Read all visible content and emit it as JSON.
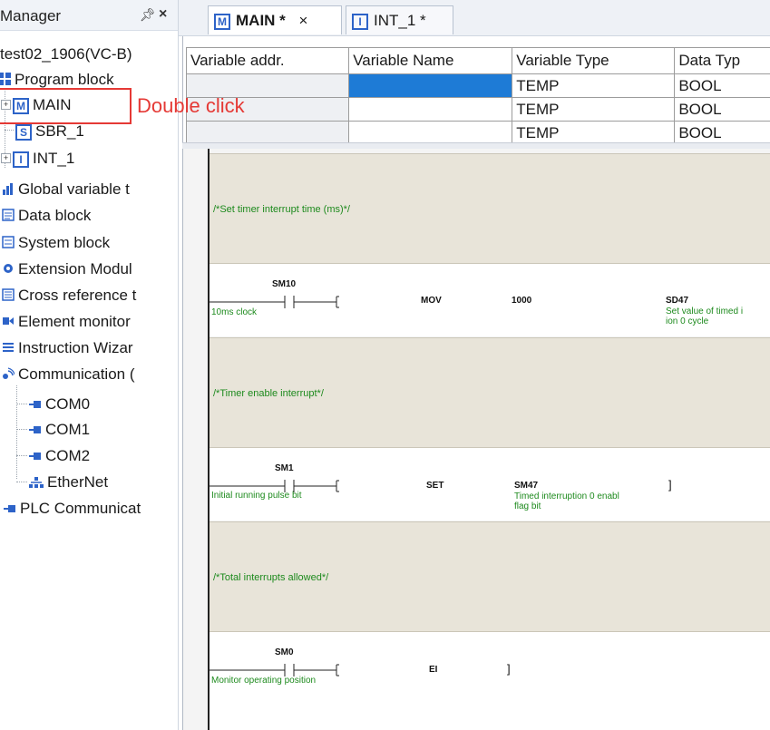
{
  "panel": {
    "title": "Manager",
    "pin_icon": "pin-icon",
    "close_icon": "close-icon",
    "project": "test02_1906(VC-B)",
    "items": [
      {
        "label": "Program block",
        "icon": "program-block-icon"
      },
      {
        "label": "MAIN",
        "icon": "main-program-icon"
      },
      {
        "label": "SBR_1",
        "icon": "subroutine-icon"
      },
      {
        "label": "INT_1",
        "icon": "interrupt-icon"
      },
      {
        "label": "Global variable t",
        "icon": "global-variable-icon"
      },
      {
        "label": "Data block",
        "icon": "data-block-icon"
      },
      {
        "label": "System block",
        "icon": "system-block-icon"
      },
      {
        "label": "Extension Modul",
        "icon": "extension-module-icon"
      },
      {
        "label": "Cross reference t",
        "icon": "cross-reference-icon"
      },
      {
        "label": "Element monitor",
        "icon": "element-monitor-icon"
      },
      {
        "label": "Instruction Wizar",
        "icon": "instruction-wizard-icon"
      },
      {
        "label": "Communication (",
        "icon": "communication-icon"
      },
      {
        "label": "COM0",
        "icon": "com-port-icon"
      },
      {
        "label": "COM1",
        "icon": "com-port-icon"
      },
      {
        "label": "COM2",
        "icon": "com-port-icon"
      },
      {
        "label": "EtherNet",
        "icon": "ethernet-icon"
      },
      {
        "label": "PLC Communicat",
        "icon": "plc-communication-icon"
      }
    ]
  },
  "annotation": {
    "text": "Double click",
    "color": "#e53935"
  },
  "tabs": [
    {
      "label": "MAIN *",
      "icon_letter": "M",
      "close": "×"
    },
    {
      "label": "INT_1 *",
      "icon_letter": "I"
    }
  ],
  "var_table": {
    "headers": [
      "Variable addr.",
      "Variable Name",
      "Variable Type",
      "Data Typ"
    ],
    "rows": [
      [
        "",
        "",
        "TEMP",
        "BOOL"
      ],
      [
        "",
        "",
        "TEMP",
        "BOOL"
      ],
      [
        "",
        "",
        "TEMP",
        "BOOL"
      ]
    ],
    "selected_color": "#1e7bd6"
  },
  "ladder": {
    "networks": [
      {
        "comment": "/*Set timer interrupt time (ms)*/",
        "contact": "SM10",
        "contact_desc": "10ms clock",
        "instruction": "MOV",
        "operand1": "1000",
        "operand2": "SD47",
        "operand2_desc_1": "Set value of timed i",
        "operand2_desc_2": "ion 0 cycle"
      },
      {
        "comment": "/*Timer enable interrupt*/",
        "contact": "SM1",
        "contact_desc": "Initial running pulse bit",
        "instruction": "SET",
        "operand1": "SM47",
        "operand1_desc_1": "Timed interruption 0 enabl",
        "operand1_desc_2": "flag bit",
        "close": "]"
      },
      {
        "comment": "/*Total interrupts allowed*/",
        "contact": "SM0",
        "contact_desc": "Monitor operating position",
        "instruction": "EI",
        "close": "]"
      }
    ]
  }
}
